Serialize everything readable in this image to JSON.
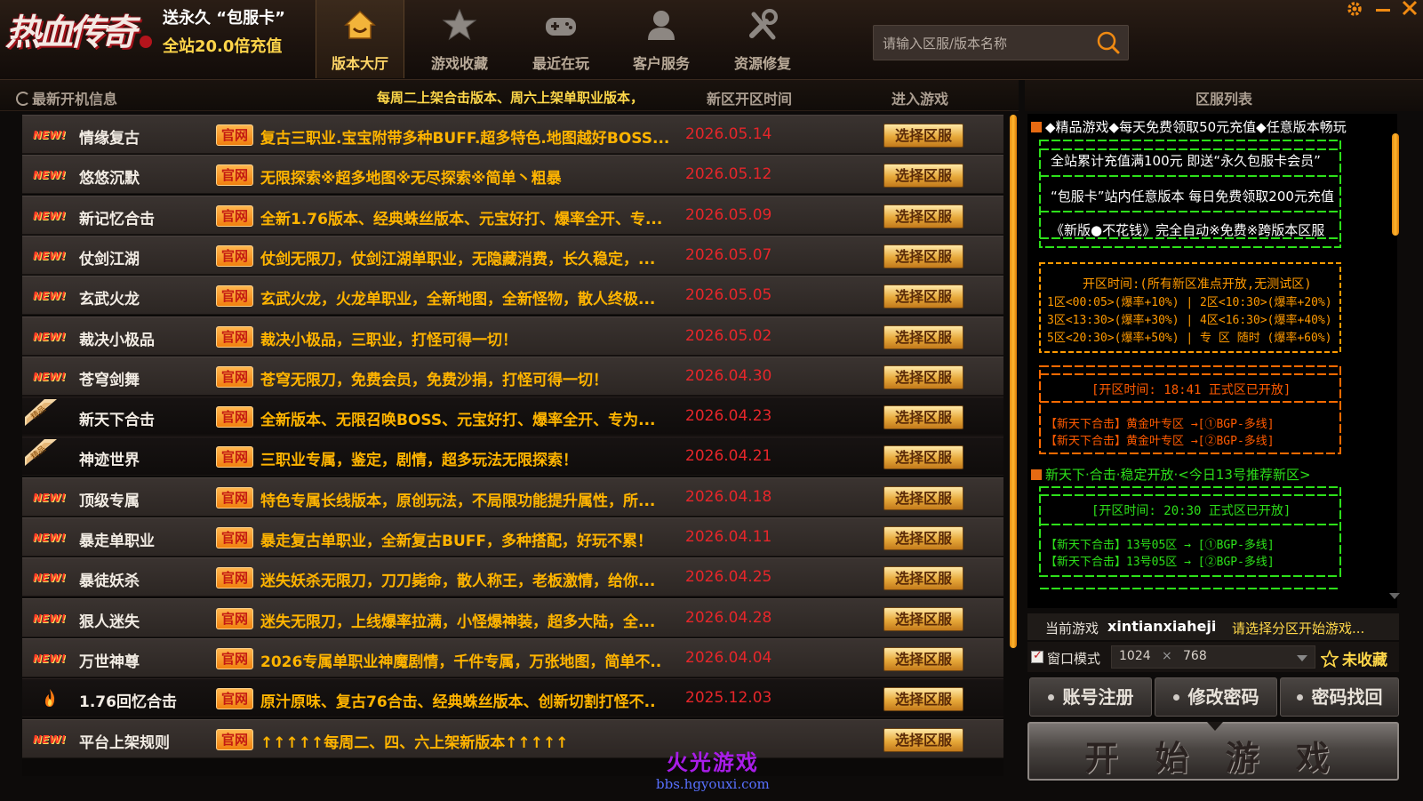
{
  "header": {
    "logo_text": "热血传奇",
    "promo_line1": "送永久 “包服卡”",
    "promo_line2": "全站20.0倍充值",
    "tabs": [
      {
        "label": "版本大厅",
        "icon": "house-icon",
        "active": true
      },
      {
        "label": "游戏收藏",
        "icon": "star-icon",
        "active": false
      },
      {
        "label": "最近在玩",
        "icon": "gamepad-icon",
        "active": false
      },
      {
        "label": "客户服务",
        "icon": "user-icon",
        "active": false
      },
      {
        "label": "资源修复",
        "icon": "tools-icon",
        "active": false
      }
    ],
    "search_placeholder": "请输入区服/版本名称"
  },
  "list_header": {
    "latest": "最新开机信息",
    "notice": "每周二上架合击版本、周六上架单职业版本，",
    "open_time": "新区开区时间",
    "enter": "进入游戏"
  },
  "games": [
    {
      "badge": "NEW!",
      "name": "情缘复古",
      "tag": "官网",
      "desc": "复古三职业.宝宝附带多种BUFF.超多特色.地图越好BOSS...",
      "date": "2026.05.14",
      "button": "选择区服",
      "dark": false
    },
    {
      "badge": "NEW!",
      "name": "悠悠沉默",
      "tag": "官网",
      "desc": "无限探索※超多地图※无尽探索※简单丶粗暴",
      "date": "2026.05.12",
      "button": "选择区服",
      "dark": false
    },
    {
      "badge": "NEW!",
      "name": "新记忆合击",
      "tag": "官网",
      "desc": "全新1.76版本、经典蛛丝版本、元宝好打、爆率全开、专...",
      "date": "2026.05.09",
      "button": "选择区服",
      "dark": false
    },
    {
      "badge": "NEW!",
      "name": "仗剑江湖",
      "tag": "官网",
      "desc": "仗剑无限刀，仗剑江湖单职业，无隐藏消费，长久稳定，...",
      "date": "2026.05.07",
      "button": "选择区服",
      "dark": false
    },
    {
      "badge": "NEW!",
      "name": "玄武火龙",
      "tag": "官网",
      "desc": "玄武火龙，火龙单职业，全新地图，全新怪物，散人终极...",
      "date": "2026.05.05",
      "button": "选择区服",
      "dark": false
    },
    {
      "badge": "NEW!",
      "name": "裁决小极品",
      "tag": "官网",
      "desc": "裁决小极品，三职业，打怪可得一切！",
      "date": "2026.05.02",
      "button": "选择区服",
      "dark": false
    },
    {
      "badge": "NEW!",
      "name": "苍穹剑舞",
      "tag": "官网",
      "desc": "苍穹无限刀，免费会员，免费沙捐，打怪可得一切！",
      "date": "2026.04.30",
      "button": "选择区服",
      "dark": false
    },
    {
      "badge": "精品",
      "name": "新天下合击",
      "tag": "官网",
      "desc": "全新版本、无限召唤BOSS、元宝好打、爆率全开、专为...",
      "date": "2026.04.23",
      "button": "选择区服",
      "dark": true
    },
    {
      "badge": "精品",
      "name": "神迹世界",
      "tag": "官网",
      "desc": "三职业专属，鉴定，剧情，超多玩法无限探索！",
      "date": "2026.04.21",
      "button": "选择区服",
      "dark": true
    },
    {
      "badge": "NEW!",
      "name": "顶级专属",
      "tag": "官网",
      "desc": "特色专属长线版本，原创玩法，不局限功能提升属性，所...",
      "date": "2026.04.18",
      "button": "选择区服",
      "dark": false
    },
    {
      "badge": "NEW!",
      "name": "暴走单职业",
      "tag": "官网",
      "desc": "暴走复古单职业，全新复古BUFF，多种搭配，好玩不累！",
      "date": "2026.04.11",
      "button": "选择区服",
      "dark": false
    },
    {
      "badge": "NEW!",
      "name": "暴徒妖杀",
      "tag": "官网",
      "desc": "迷失妖杀无限刀，刀刀毙命，散人称王，老板激情，给你...",
      "date": "2026.04.25",
      "button": "选择区服",
      "dark": false
    },
    {
      "badge": "NEW!",
      "name": "狠人迷失",
      "tag": "官网",
      "desc": "迷失无限刀，上线爆率拉满，小怪爆神装，超多大陆，全...",
      "date": "2026.04.28",
      "button": "选择区服",
      "dark": false
    },
    {
      "badge": "NEW!",
      "name": "万世神尊",
      "tag": "官网",
      "desc": "2026专属单职业神魔剧情，千件专属，万张地图，简单不..",
      "date": "2026.04.04",
      "button": "选择区服",
      "dark": false
    },
    {
      "badge": "fire",
      "name": "1.76回忆合击",
      "tag": "官网",
      "desc": "原汁原味、复古76合击、经典蛛丝版本、创新切割打怪不..",
      "date": "2025.12.03",
      "button": "选择区服",
      "dark": true
    },
    {
      "badge": "NEW!",
      "name": "平台上架规则",
      "tag": "官网",
      "desc": "↑↑↑↑↑每周二、四、六上架新版本↑↑↑↑↑",
      "date": "",
      "button": "选择区服",
      "dark": false
    }
  ],
  "watermark": {
    "title": "火光游戏",
    "url": "bbs.hgyouxi.com"
  },
  "server_panel": {
    "title": "区服列表",
    "section1_title": "◆精品游戏◆每天免费领取50元充值◆任意版本畅玩",
    "promo_lines": [
      "全站累计充值满100元   即送“永久包服卡会员”",
      "“包服卡”站内任意版本 每日免费领取200元充值",
      "《新版●不花钱》完全自动※免费※跨版本区服"
    ],
    "schedule_title": "开区时间:(所有新区准点开放,无测试区)",
    "schedule_lines": [
      "1区<00:05>(爆率+10%) | 2区<10:30>(爆率+20%)",
      "3区<13:30>(爆率+30%) | 4区<16:30>(爆率+40%)",
      "5区<20:30>(爆率+50%) | 专 区 随时 (爆率+60%)"
    ],
    "box3_time": "[开区时间: 18:41 正式区已开放]",
    "box3_lines": [
      "【新天下合击】黄金叶专区  →[①BGP-多线]",
      "【新天下合击】黄金叶专区  →[②BGP-多线]"
    ],
    "section2_title": "新天下·合击·稳定开放·<今日13号推荐新区>",
    "box4_time": "[开区时间: 20:30 正式区已开放]",
    "box4_lines": [
      "【新天下合击】13号05区  →  [①BGP-多线]",
      "【新天下合击】13号05区  →  [②BGP-多线]"
    ]
  },
  "current_game": {
    "label": "当前游戏",
    "name": "xintianxiaheji",
    "hint": "请选择分区开始游戏..."
  },
  "window_mode": {
    "label": "窗口模式",
    "checked": true,
    "width": "1024",
    "times": "×",
    "height": "768",
    "fav_label": "未收藏"
  },
  "account_buttons": [
    "账号注册",
    "修改密码",
    "密码找回"
  ],
  "start_button": "开 始 游 戏",
  "colors": {
    "accent_gold": "#ffd84a",
    "date_red": "#e6262a",
    "desc_orange": "#ffb400",
    "panel_green": "#2de01a"
  }
}
